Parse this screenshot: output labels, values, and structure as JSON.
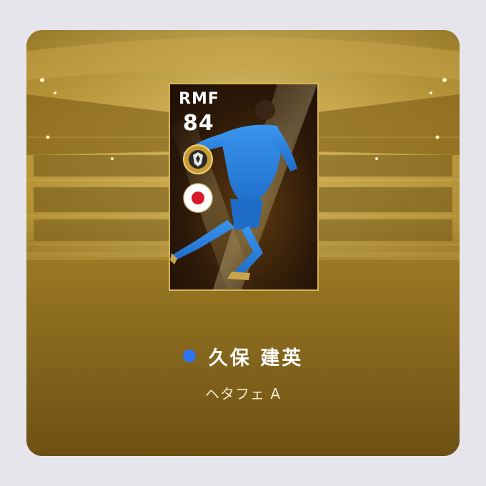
{
  "card": {
    "position": "RMF",
    "rating": "84",
    "emblem_icon": "team-emblem-icon",
    "flag_icon": "japan-flag-icon",
    "kit_color": "#2f86e0"
  },
  "player": {
    "name": "久保 建英",
    "club": "ヘタフェ A",
    "status_dot_color": "#2f74f0"
  }
}
